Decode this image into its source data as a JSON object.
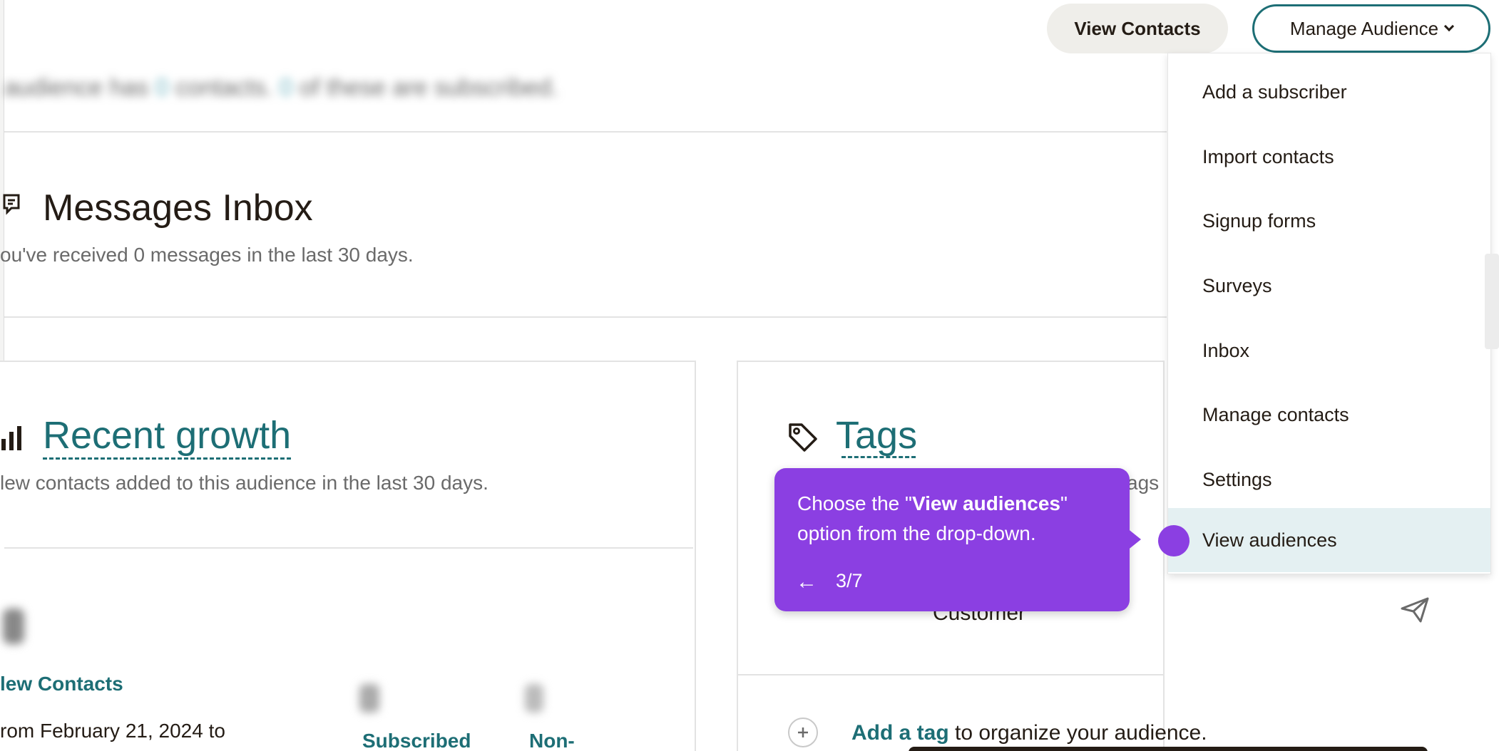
{
  "header": {
    "view_contacts_label": "View Contacts",
    "manage_audience_label": "Manage Audience"
  },
  "summary": {
    "prefix": "audience has",
    "contacts_count": "0",
    "middle": "contacts.",
    "subscribed_count": "0",
    "suffix": "of these are subscribed."
  },
  "inbox": {
    "title": "Messages Inbox",
    "description": "ou've received 0 messages in the last 30 days."
  },
  "growth": {
    "title": "Recent growth",
    "description": "lew contacts added to this audience in the last 30 days.",
    "new_contacts_label": "lew Contacts",
    "date_range": "rom February 21, 2024 to",
    "subscribed_label": "Subscribed",
    "non_label": "Non-"
  },
  "tags": {
    "title": "Tags",
    "description_fragment": "ags",
    "tag_name": "Customer",
    "add_tag_link": "Add a tag",
    "add_tag_rest": " to organize your audience."
  },
  "dropdown": {
    "items": [
      {
        "label": "Add a subscriber"
      },
      {
        "label": "Import contacts"
      },
      {
        "label": "Signup forms"
      },
      {
        "label": "Surveys"
      },
      {
        "label": "Inbox"
      },
      {
        "label": "Manage contacts"
      },
      {
        "label": "Settings"
      },
      {
        "label": "View audiences",
        "active": true
      }
    ]
  },
  "tooltip": {
    "text_before": "Choose the \"",
    "text_bold": "View audiences",
    "text_after": "\" option from the drop-down.",
    "back_arrow": "←",
    "step": "3/7"
  },
  "colors": {
    "accent_teal": "#1d6e75",
    "tooltip_purple": "#8b3fe2",
    "active_item_bg": "#e4f0f2"
  },
  "icons": {
    "inbox": "chat-lines-icon",
    "growth": "bar-chart-icon",
    "tags": "tag-icon",
    "send": "send-icon",
    "add": "plus-circle-icon",
    "dropdown": "chevron-down-icon"
  }
}
